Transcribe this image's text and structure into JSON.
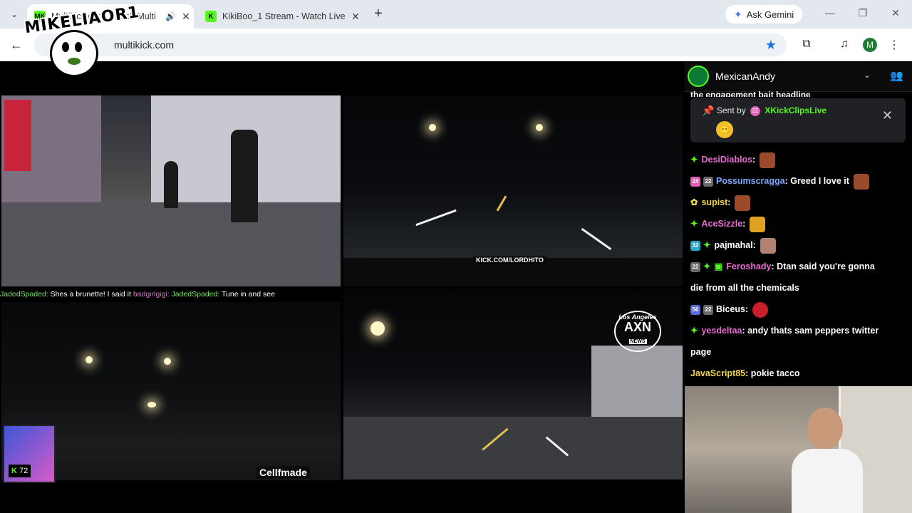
{
  "browser": {
    "tabs": [
      {
        "title": "Multikick.com: Watch Multi",
        "favicon": "MK",
        "active": true,
        "audio": true
      },
      {
        "title": "KikiBoo_1 Stream - Watch Live o",
        "favicon": "K",
        "active": false
      }
    ],
    "new_tab_label": "+",
    "gemini_label": "Ask Gemini",
    "url": "multikick.com",
    "profile_initial": "M"
  },
  "overlay_logo": "MIKELIAOR1",
  "streams": [
    {
      "watermark": ""
    },
    {
      "watermark": "KICK.COM/LORDHITO"
    },
    {
      "watermark": "Cellfmade",
      "viewer_count": "72"
    },
    {
      "watermark": "AXN NEWS",
      "logo_small": "Los Angeles",
      "logo_big": "AXN",
      "logo_news": "NEWS"
    }
  ],
  "ticker": {
    "m1_user": "JadedSpaded:",
    "m1_text": " Shes a brunette! I said it ",
    "m2_user": "badgirlgigi:",
    "m3_user": "JadedSpaded:",
    "m3_text": " Tune in and see"
  },
  "chat": {
    "channel": "MexicanAndy",
    "partial_top": "the engagement bait headline",
    "pinned": {
      "sent_by_label": "Sent by",
      "sender": "XKickClipsLive",
      "badge": "22"
    },
    "messages": [
      {
        "user": "DesiDiablos",
        "text": "",
        "badges": [
          "sparkle"
        ],
        "user_color": "pink",
        "emote": true
      },
      {
        "user": "Possumscragga",
        "text": "Greed I love it",
        "badges": [
          "24",
          "22"
        ],
        "user_color": "blue",
        "emote": true
      },
      {
        "user": "supist",
        "text": "",
        "badges": [
          "gift"
        ],
        "user_color": "yellow",
        "emote": true
      },
      {
        "user": "AceSizzle",
        "text": "",
        "badges": [
          "sparkle"
        ],
        "user_color": "pink",
        "emote": true
      },
      {
        "user": "pajmahal",
        "text": "",
        "badges": [
          "32",
          "sparkle"
        ],
        "user_color": "white",
        "emote": true
      },
      {
        "user": "Feroshady",
        "text": "Dtan said you're gonna",
        "continuation": "die from all the chemicals",
        "badges": [
          "22",
          "sparkle",
          "gift"
        ],
        "user_color": "pink"
      },
      {
        "user": "Biceus",
        "text": "",
        "badges": [
          "56",
          "22"
        ],
        "user_color": "white",
        "emote": true
      },
      {
        "user": "yesdeltaa",
        "text": "andy thats sam peppers twitter",
        "continuation": "page",
        "badges": [
          "sparkle"
        ],
        "user_color": "pink"
      },
      {
        "user": "JavaScript85",
        "text": "pokie tacco",
        "badges": [],
        "user_color": "yellow"
      }
    ]
  },
  "colors": {
    "kick_green": "#53fc18",
    "chat_bg": "#000000",
    "browser_chrome": "#e3e8ee"
  }
}
